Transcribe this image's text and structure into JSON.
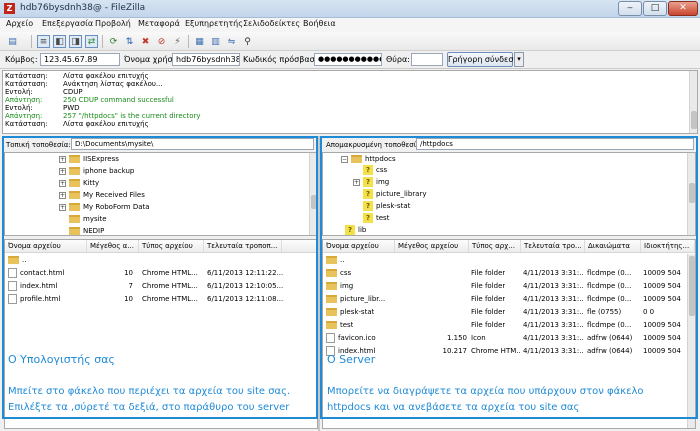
{
  "window": {
    "title": "hdb76bysdnh38@ - FileZilla",
    "app_icon": "Z",
    "minimize": "‒",
    "maximize": "□",
    "close": "✕"
  },
  "menu": [
    "Αρχείο",
    "Επεξεργασία",
    "Προβολή",
    "Μεταφορά",
    "Εξυπηρετητής",
    "Σελιδοδείκτες",
    "Βοήθεια"
  ],
  "quickconnect": {
    "host_label": "Κόμβος:",
    "host_value": "123.45.67.89",
    "user_label": "Όνομα χρήστη:",
    "user_value": "hdb76bysdnh38",
    "pass_label": "Κωδικός πρόσβασης:",
    "pass_value": "●●●●●●●●●●●●●",
    "port_label": "Θύρα:",
    "port_value": "",
    "connect_label": "Γρήγορη σύνδεση",
    "dropdown": "▾"
  },
  "log": [
    {
      "k": "Κατάσταση:",
      "v": "Λίστα φακέλου επιτυχής",
      "c": "#000000"
    },
    {
      "k": "Κατάσταση:",
      "v": "Ανάκτηση λίστας φακέλου...",
      "c": "#000000"
    },
    {
      "k": "Εντολή:",
      "v": "CDUP",
      "c": "#000000"
    },
    {
      "k": "Απάντηση:",
      "v": "250 CDUP command successful",
      "c": "#1a8c1a"
    },
    {
      "k": "Εντολή:",
      "v": "PWD",
      "c": "#000000"
    },
    {
      "k": "Απάντηση:",
      "v": "257 \"/httpdocs\" is the current directory",
      "c": "#1a8c1a"
    },
    {
      "k": "Κατάσταση:",
      "v": "Λίστα φακέλου επιτυχής",
      "c": "#000000"
    }
  ],
  "local": {
    "path_label": "Τοπική τοποθεσία:",
    "path_value": "D:\\Documents\\mysite\\",
    "tree": [
      "IISExpress",
      "iphone backup",
      "Kitty",
      "My Received Files",
      "My RoboForm Data",
      "mysite",
      "NEDIP"
    ],
    "columns": [
      "Όνομα αρχείου",
      "Μέγεθος α...",
      "Τύπος αρχείου",
      "Τελευταία τροποπ..."
    ],
    "files": [
      {
        "name": "..",
        "size": "",
        "type": "",
        "date": ""
      },
      {
        "name": "contact.html",
        "size": "10",
        "type": "Chrome HTML...",
        "date": "6/11/2013 12:11:22..."
      },
      {
        "name": "index.html",
        "size": "7",
        "type": "Chrome HTML...",
        "date": "6/11/2013 12:10:05..."
      },
      {
        "name": "profile.html",
        "size": "10",
        "type": "Chrome HTML...",
        "date": "6/11/2013 12:11:08..."
      }
    ],
    "caption_title": "Ο Υπολογιστής σας",
    "caption_line1": "Μπείτε στο φάκελο που περιέχει τα αρχεία του site σας.",
    "caption_line2": "Επιλέξτε τα ,σύρετέ τα δεξιά, στο παράθυρο του server"
  },
  "remote": {
    "path_label": "Απομακρυσμένη τοποθεσία:",
    "path_value": "/httpdocs",
    "tree_root": "httpdocs",
    "tree": [
      "css",
      "img",
      "picture_library",
      "plesk-stat",
      "test"
    ],
    "tree_after": "lib",
    "columns": [
      "Όνομα αρχείου",
      "Μέγεθος αρχείου",
      "Τύπος αρχ...",
      "Τελευταία τρο...",
      "Δικαιώματα",
      "Ιδιοκτήτης..."
    ],
    "files": [
      {
        "name": "..",
        "size": "",
        "type": "",
        "date": "",
        "perm": "",
        "owner": ""
      },
      {
        "name": "css",
        "size": "",
        "type": "File folder",
        "date": "4/11/2013 3:31:...",
        "perm": "flcdmpe (0...",
        "owner": "10009 504"
      },
      {
        "name": "img",
        "size": "",
        "type": "File folder",
        "date": "4/11/2013 3:31:...",
        "perm": "flcdmpe (0...",
        "owner": "10009 504"
      },
      {
        "name": "picture_libr...",
        "size": "",
        "type": "File folder",
        "date": "4/11/2013 3:31:...",
        "perm": "flcdmpe (0...",
        "owner": "10009 504"
      },
      {
        "name": "plesk-stat",
        "size": "",
        "type": "File folder",
        "date": "4/11/2013 3:31:...",
        "perm": "fle (0755)",
        "owner": "0 0"
      },
      {
        "name": "test",
        "size": "",
        "type": "File folder",
        "date": "4/11/2013 3:31:...",
        "perm": "flcdmpe (0...",
        "owner": "10009 504"
      },
      {
        "name": "favicon.ico",
        "size": "1.150",
        "type": "Icon",
        "date": "4/11/2013 3:31:...",
        "perm": "adfrw (0644)",
        "owner": "10009 504"
      },
      {
        "name": "index.html",
        "size": "10.217",
        "type": "Chrome HTM...",
        "date": "4/11/2013 3:31:...",
        "perm": "adfrw (0644)",
        "owner": "10009 504"
      }
    ],
    "caption_title": "Ο Server",
    "caption_line1": "Μπορείτε να διαγράψετε τα αρχεία που υπάρχουν στον φάκελο",
    "caption_line2": "httpdocs και να ανεβάσετε τα αρχεία του site σας"
  },
  "accent_color": "#1f8ad6"
}
